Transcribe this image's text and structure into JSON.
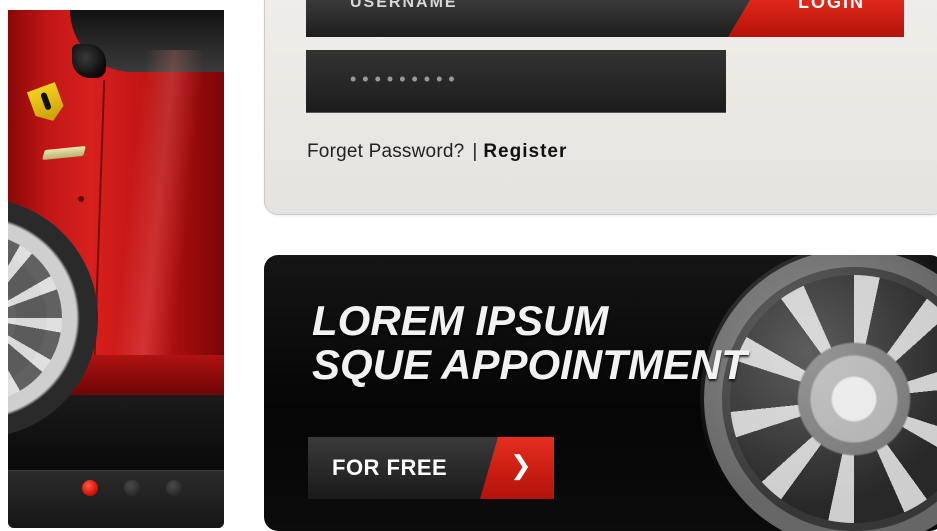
{
  "hero": {
    "slider_dots": [
      {
        "state": "active"
      },
      {
        "state": "inactive"
      },
      {
        "state": "inactive"
      }
    ]
  },
  "login": {
    "username_value": "USERNAME",
    "password_value": "•••••••••",
    "login_button": "LOGIN",
    "forgot_link": "Forget Password?",
    "separator": "|",
    "register_link": "Register"
  },
  "promo": {
    "headline_line1": "LOREM IPSUM",
    "headline_line2": "SQUE APPOINTMENT",
    "cta_label": "FOR FREE",
    "cta_icon": "chevron-right-icon"
  },
  "colors": {
    "accent_red": "#d6140c",
    "field_dark": "#1c1c1c",
    "panel_bg": "#e6e3de",
    "banner_bg": "#050505"
  }
}
